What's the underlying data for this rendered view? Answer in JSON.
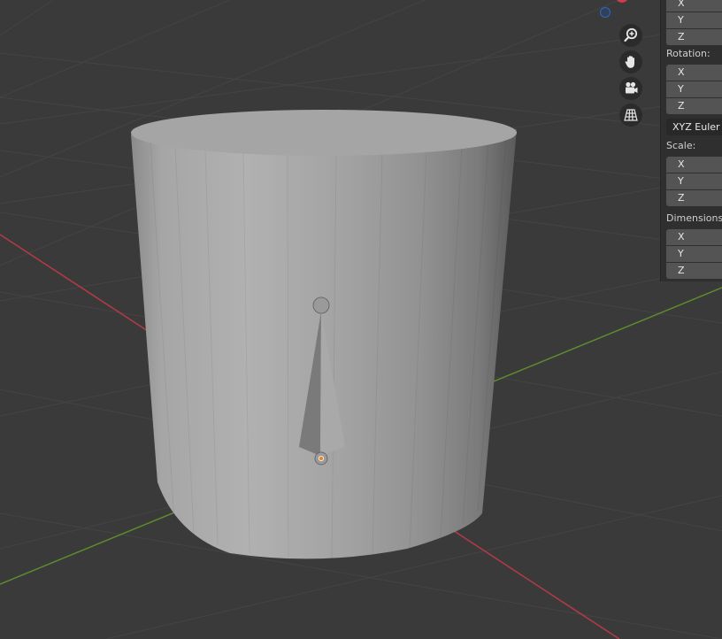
{
  "viewport": {
    "object": "cylinder",
    "armature_bone": "bone",
    "origin_marker": "object-origin"
  },
  "navigation": {
    "zoom_icon": "zoom-in-icon",
    "pan_icon": "hand-pan-icon",
    "camera_icon": "camera-icon",
    "perspective_icon": "grid-perspective-icon"
  },
  "axis_colors": {
    "x": "#d23c4a",
    "y": "#5f8f2b",
    "z": "#2e67bf"
  },
  "sidebar": {
    "location": {
      "fields": [
        "X",
        "Y",
        "Z"
      ]
    },
    "rotation": {
      "label": "Rotation:",
      "fields": [
        "X",
        "Y",
        "Z"
      ],
      "mode": "XYZ Euler"
    },
    "scale": {
      "label": "Scale:",
      "fields": [
        "X",
        "Y",
        "Z"
      ]
    },
    "dimensions": {
      "label": "Dimensions:",
      "fields": [
        "X",
        "Y",
        "Z"
      ]
    }
  }
}
